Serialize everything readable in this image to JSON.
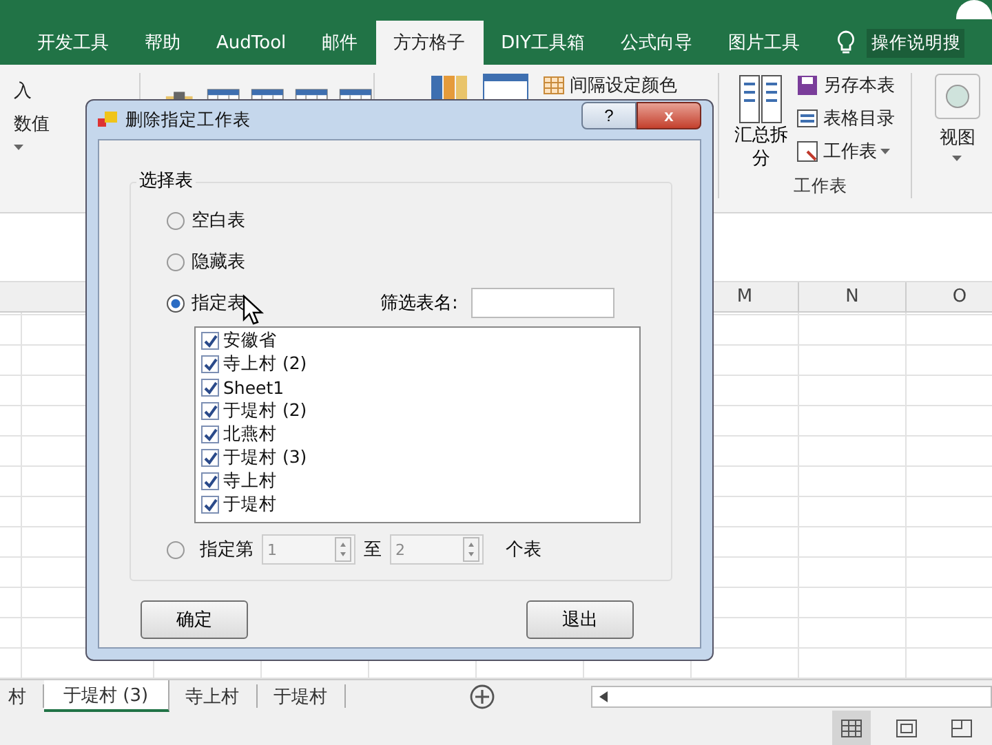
{
  "ribbon_tabs": [
    {
      "label": "开发工具",
      "selected": false
    },
    {
      "label": "帮助",
      "selected": false
    },
    {
      "label": "AudTool",
      "selected": false
    },
    {
      "label": "邮件",
      "selected": false
    },
    {
      "label": "方方格子",
      "selected": true
    },
    {
      "label": "DIY工具箱",
      "selected": false
    },
    {
      "label": "公式向导",
      "selected": false
    },
    {
      "label": "图片工具",
      "selected": false
    }
  ],
  "tell_me": "操作说明搜",
  "ribbon": {
    "left_items": [
      "入",
      "数值"
    ],
    "interval_color": "间隔设定颜色",
    "summary_split": "汇总拆分",
    "save_sheet": "另存本表",
    "table_toc": "表格目录",
    "worksheet": "工作表",
    "group_label": "工作表",
    "view": "视图"
  },
  "columns": [
    "M",
    "N",
    "O"
  ],
  "sheet_tabs": [
    {
      "label": "村",
      "selected": false
    },
    {
      "label": "于堤村 (3)",
      "selected": true
    },
    {
      "label": "寺上村",
      "selected": false
    },
    {
      "label": "于堤村",
      "selected": false
    }
  ],
  "dialog": {
    "title": "删除指定工作表",
    "help": "?",
    "close": "x",
    "group": "选择表",
    "options": [
      {
        "label": "空白表",
        "selected": false
      },
      {
        "label": "隐藏表",
        "selected": false
      },
      {
        "label": "指定表",
        "selected": true
      }
    ],
    "filter_label": "筛选表名:",
    "sheets": [
      {
        "label": "安徽省",
        "checked": true
      },
      {
        "label": "寺上村 (2)",
        "checked": true
      },
      {
        "label": "Sheet1",
        "checked": true
      },
      {
        "label": "于堤村 (2)",
        "checked": true
      },
      {
        "label": "北燕村",
        "checked": true
      },
      {
        "label": "于堤村 (3)",
        "checked": true
      },
      {
        "label": "寺上村",
        "checked": true
      },
      {
        "label": "于堤村",
        "checked": true
      }
    ],
    "range": {
      "label": "指定第",
      "from": "1",
      "to_label": "至",
      "to": "2",
      "suffix": "个表",
      "selected": false
    },
    "ok": "确定",
    "exit": "退出"
  }
}
